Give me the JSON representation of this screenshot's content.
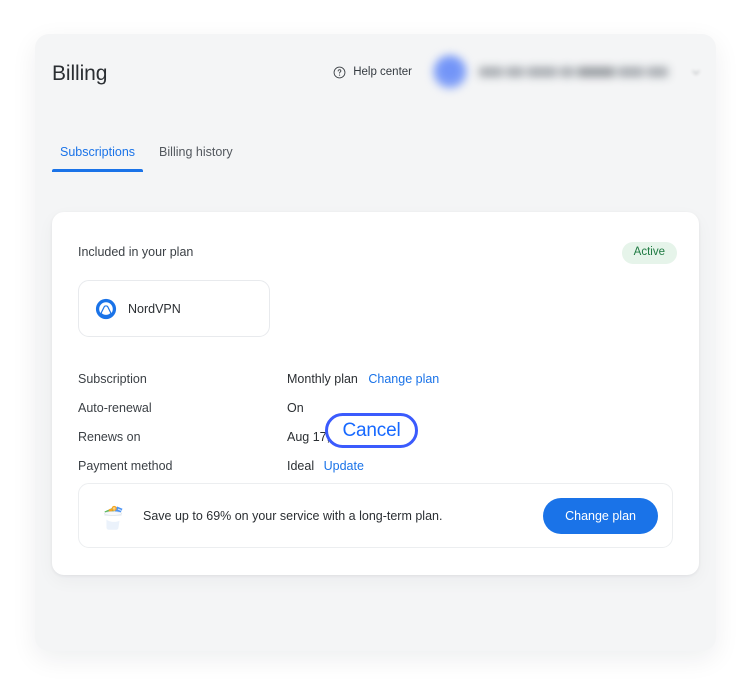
{
  "header": {
    "title": "Billing",
    "help_center_label": "Help center",
    "help_icon": "question-circle-icon",
    "account_email_redacted": "",
    "caret_icon": "chevron-down-icon"
  },
  "tabs": [
    {
      "label": "Subscriptions",
      "active": true
    },
    {
      "label": "Billing history",
      "active": false
    }
  ],
  "plan_card": {
    "section_label": "Included in your plan",
    "status_badge": "Active",
    "status_badge_bg": "#e6f4ea",
    "status_badge_color": "#1e7a42",
    "product": {
      "name": "NordVPN",
      "logo_icon": "nordvpn-logo-icon"
    },
    "details": [
      {
        "label": "Subscription",
        "value": "Monthly plan",
        "link": "Change plan"
      },
      {
        "label": "Auto-renewal",
        "value": "On",
        "link": "Cancel"
      },
      {
        "label": "Renews on",
        "value": "Aug 17, 2040",
        "link": ""
      },
      {
        "label": "Payment method",
        "value": "Ideal",
        "link": "Update"
      }
    ],
    "annotation": {
      "highlighted_label": "Cancel",
      "ring_color": "#3b5bfd",
      "text_color": "#1769ff"
    },
    "promo": {
      "icon": "money-bucket-icon",
      "text": "Save up to 69% on your service with a long-term plan.",
      "button_label": "Change plan",
      "button_color": "#1a73e8"
    }
  },
  "colors": {
    "accent": "#1a73e8",
    "page_bg": "#ffffff",
    "panel_bg": "#f4f5f6",
    "card_bg": "#ffffff"
  }
}
